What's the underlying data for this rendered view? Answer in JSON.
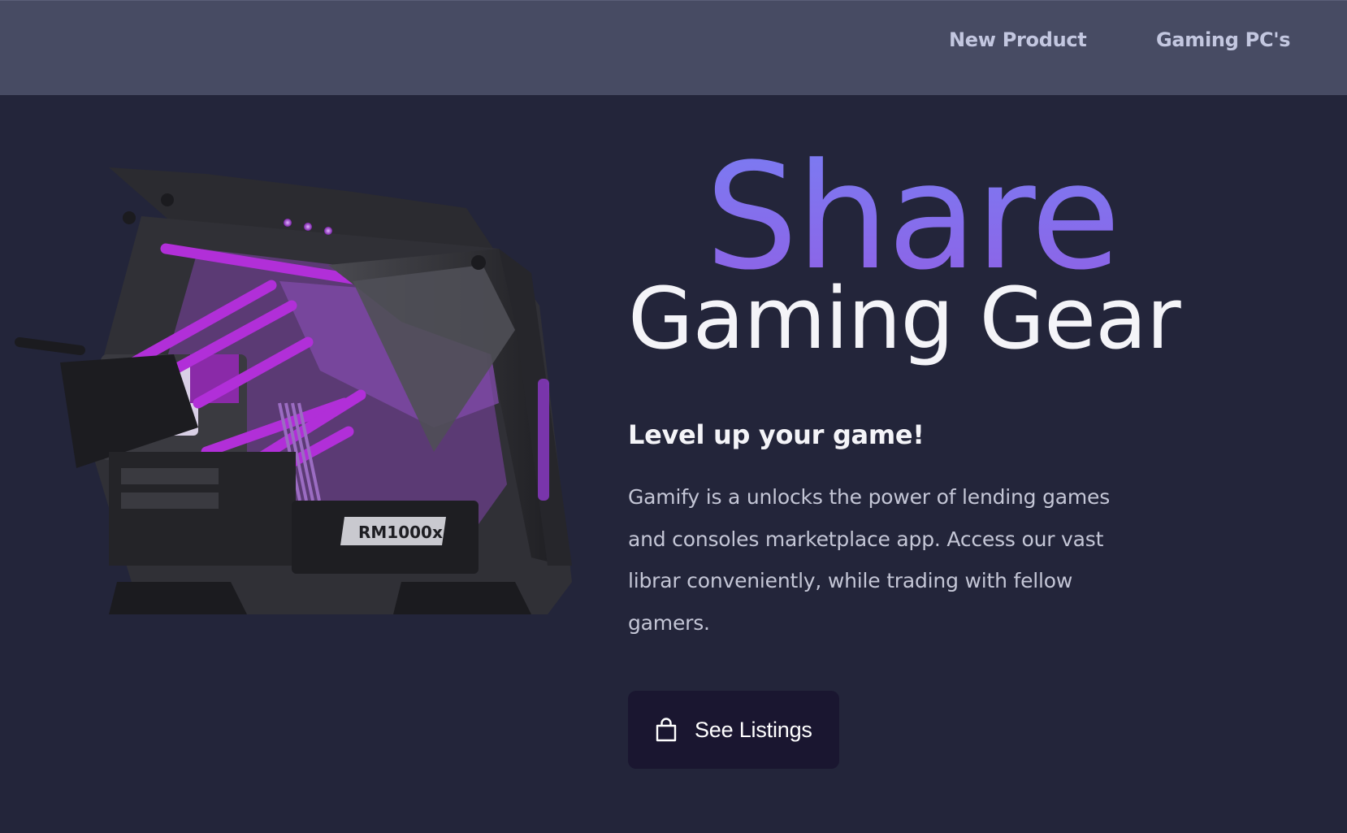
{
  "nav": {
    "items": [
      {
        "label": "New Product"
      },
      {
        "label": "Gaming PC's"
      }
    ]
  },
  "hero": {
    "image_icon": "gaming-pc-image",
    "headline_top": "Share",
    "headline_bottom": "Gaming Gear",
    "subheading": "Level up your game!",
    "description": "Gamify is a unlocks the power of lending games and consoles marketplace app. Access our vast librar conveniently, while trading with fellow gamers.",
    "cta": {
      "label": "See Listings",
      "icon": "shopping-bag-icon"
    },
    "psu_label": "RM1000x"
  },
  "colors": {
    "background": "#23253a",
    "navbar": "#474b63",
    "nav_text": "#c3c7e0",
    "accent_gradient_start": "#7b7bf2",
    "accent_gradient_end": "#8e62e6",
    "cta_background": "#1a1630",
    "tubing_purple": "#b12fd8"
  }
}
